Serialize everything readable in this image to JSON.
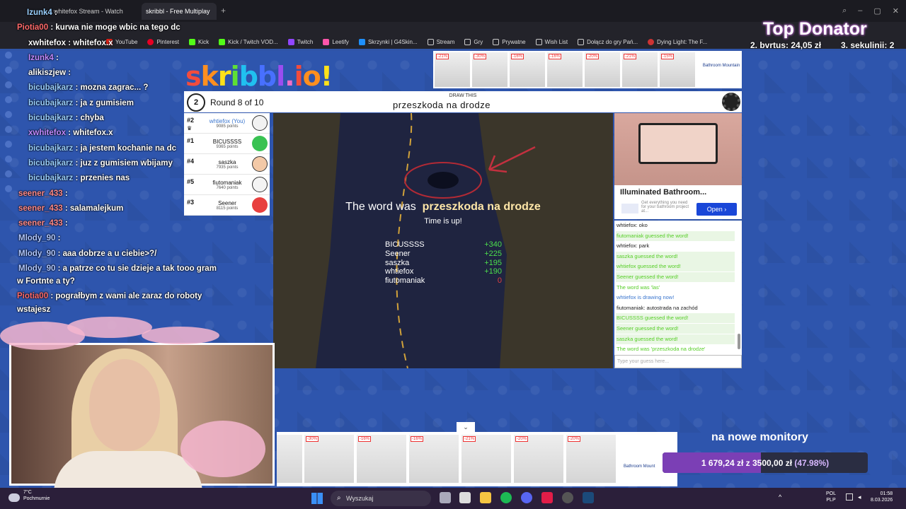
{
  "browser": {
    "tabs": [
      {
        "label": "whitefox Stream - Watch"
      },
      {
        "label": "skribbl - Free Multiplay"
      }
    ],
    "bookmarks": [
      "YouTube",
      "Pinterest",
      "Kick",
      "Kick / Twitch VOD...",
      "Twitch",
      "Leetify",
      "Skrzynki | G4Skin...",
      "Stream",
      "Gry",
      "Prywatne",
      "Wish List",
      "Dołącz do gry Pań...",
      "Dying Light: The F..."
    ]
  },
  "stream_chat": [
    {
      "user": "Izunk4",
      "text": ":"
    },
    {
      "user": "Piotia00",
      "text": ": kurwa nie moge wbic na tego dc"
    },
    {
      "user": "xwhitefox",
      "text": ": whitefox.x"
    },
    {
      "user": "Izunk4",
      "text": ":"
    },
    {
      "user": "alikiszjew",
      "text": ":"
    },
    {
      "user": "bicubajkarz",
      "text": ": mozna zagrac... ?"
    },
    {
      "user": "bicubajkarz",
      "text": ": ja z gumisiem"
    },
    {
      "user": "bicubajkarz",
      "text": ": chyba"
    },
    {
      "user": "xwhitefox",
      "text": ": whitefox.x"
    },
    {
      "user": "bicubajkarz",
      "text": ": ja jestem kochanie na dc"
    },
    {
      "user": "bicubajkarz",
      "text": ": juz z gumisiem wbijamy"
    },
    {
      "user": "bicubajkarz",
      "text": ": przenies nas"
    },
    {
      "user": "seener_433",
      "text": ":"
    },
    {
      "user": "seener_433",
      "text": ": salamalejkum"
    },
    {
      "user": "seener_433",
      "text": ":"
    },
    {
      "user": "Mlody_90",
      "text": ":"
    },
    {
      "user": "Mlody_90",
      "text": ": aaa dobrze a u ciebie>?/"
    },
    {
      "user": "Mlody_90",
      "text": ": a patrze co tu sie dzieje a tak tooo gram"
    },
    {
      "user": "",
      "text": "w Fortnte a ty?"
    },
    {
      "user": "Piotia00",
      "text": ": pograłbym z wami ale zaraz do roboty"
    },
    {
      "user": "",
      "text": "wstajesz"
    }
  ],
  "game": {
    "logo": "skribbl.io",
    "round_timer": "2",
    "round": "Round 8 of 10",
    "draw_this": "DRAW THIS",
    "word": "przeszkoda na drodze",
    "players": [
      {
        "rank": "#2",
        "name": "whtiefox (You)",
        "points": "9085 points",
        "color": "#f2f2f2",
        "you": true
      },
      {
        "rank": "#1",
        "name": "BICUSSSS",
        "points": "9365 points",
        "color": "#39c252"
      },
      {
        "rank": "#4",
        "name": "saszka",
        "points": "7935 points",
        "color": "#f3c9a7"
      },
      {
        "rank": "#5",
        "name": "fiutomaniak",
        "points": "7640 points",
        "color": "#f4f4f4"
      },
      {
        "rank": "#3",
        "name": "Seener",
        "points": "8115 points",
        "color": "#e8403f"
      }
    ],
    "result_prefix": "The word was",
    "result_word": "przeszkoda na drodze",
    "time_up": "Time is up!",
    "scores": [
      {
        "name": "BICUSSSS",
        "value": "+340"
      },
      {
        "name": "Seener",
        "value": "+225"
      },
      {
        "name": "saszka",
        "value": "+195"
      },
      {
        "name": "whtiefox",
        "value": "+190"
      },
      {
        "name": "fiutomaniak",
        "value": "0"
      }
    ],
    "chat": [
      {
        "text": "whtiefox: oko",
        "type": "n"
      },
      {
        "text": "fiutomaniak guessed the word!",
        "type": "g"
      },
      {
        "text": "whtiefox: park",
        "type": "n"
      },
      {
        "text": "saszka guessed the word!",
        "type": "g"
      },
      {
        "text": "whtiefox guessed the word!",
        "type": "g"
      },
      {
        "text": "Seener guessed the word!",
        "type": "g"
      },
      {
        "text": "The word was 'las'",
        "type": "gw"
      },
      {
        "text": "whtiefox is drawing now!",
        "type": "b"
      },
      {
        "text": "fiutomaniak: autostrada na zachód",
        "type": "n"
      },
      {
        "text": "BICUSSSS guessed the word!",
        "type": "g"
      },
      {
        "text": "Seener guessed the word!",
        "type": "g"
      },
      {
        "text": "saszka guessed the word!",
        "type": "g"
      },
      {
        "text": "The word was 'przeszkoda na drodze'",
        "type": "gw"
      }
    ],
    "input_placeholder": "Type your guess here..."
  },
  "ads": {
    "top_discounts": [
      "-21%",
      "-30%",
      "-16%",
      "-16%",
      "-20%",
      "-21%",
      "-15%"
    ],
    "top_brand": "Bathroom Mountain",
    "right_title": "Illuminated Bathroom...",
    "right_sub": "Get everything you need for your bathroom project at...",
    "right_button": "Open",
    "bottom_discounts": [
      "-30%",
      "-16%",
      "-16%",
      "-21%",
      "-20%",
      "-20%"
    ],
    "bottom_brand": "Bathroom Mount"
  },
  "overlay": {
    "donor_title": "Top Donator",
    "donors": [
      {
        "text": "2. bvrtus: 24,05 zł"
      },
      {
        "text": "3. sekulinii: 2"
      }
    ],
    "goal_title": "na nowe monitory",
    "goal_current": "1 679,24 zł",
    "goal_sep": "z",
    "goal_target": "3500,00 zł",
    "goal_percent": "(47.98%)",
    "goal_fraction": 0.4798
  },
  "taskbar": {
    "weather_temp": "7°C",
    "weather_desc": "Pochmurnie",
    "search": "Wyszukaj",
    "lang1": "POL",
    "lang2": "PLP",
    "time": "01:58",
    "date": "8.03.2026"
  }
}
